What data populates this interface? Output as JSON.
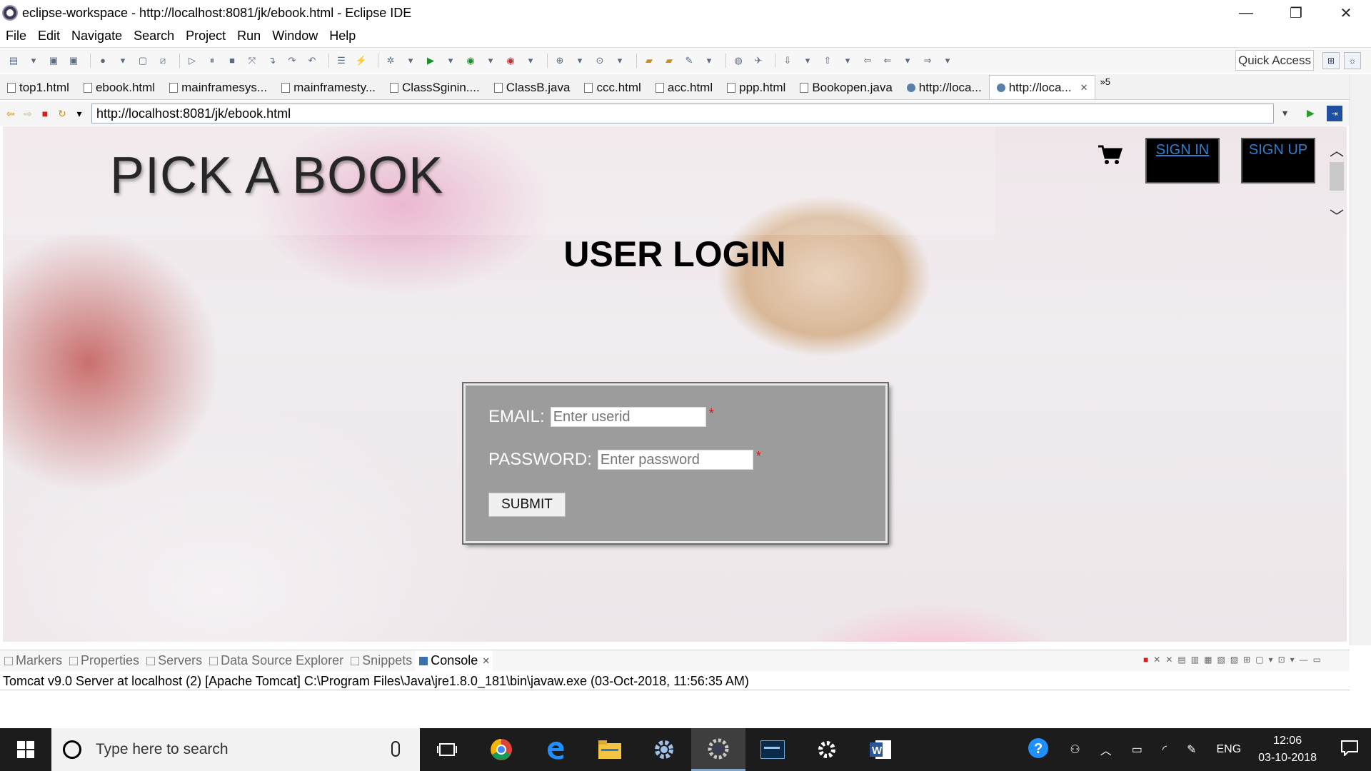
{
  "window": {
    "title": "eclipse-workspace - http://localhost:8081/jk/ebook.html - Eclipse IDE",
    "minimize": "—",
    "restore": "❐",
    "close": "✕"
  },
  "menu": [
    "File",
    "Edit",
    "Navigate",
    "Search",
    "Project",
    "Run",
    "Window",
    "Help"
  ],
  "toolbar": {
    "quick_access": "Quick Access"
  },
  "editor_tabs": [
    {
      "label": "top1.html",
      "kind": "file"
    },
    {
      "label": "ebook.html",
      "kind": "file"
    },
    {
      "label": "mainframesys...",
      "kind": "file"
    },
    {
      "label": "mainframesty...",
      "kind": "file"
    },
    {
      "label": "ClassSginin....",
      "kind": "file"
    },
    {
      "label": "ClassB.java",
      "kind": "file"
    },
    {
      "label": "ccc.html",
      "kind": "file"
    },
    {
      "label": "acc.html",
      "kind": "file"
    },
    {
      "label": "ppp.html",
      "kind": "file"
    },
    {
      "label": "Bookopen.java",
      "kind": "file"
    },
    {
      "label": "http://loca...",
      "kind": "web"
    },
    {
      "label": "http://loca...",
      "kind": "web",
      "active": true
    }
  ],
  "tab_overflow": "»5",
  "browser": {
    "url": "http://localhost:8081/jk/ebook.html"
  },
  "page": {
    "brand": "PICK A BOOK",
    "sign_in": "SIGN IN",
    "sign_up": "SIGN UP",
    "login_title": "USER LOGIN",
    "email_label": "EMAIL:",
    "email_placeholder": "Enter userid",
    "password_label": "PASSWORD:",
    "password_placeholder": "Enter password",
    "required_mark": "*",
    "submit": "SUBMIT"
  },
  "views": {
    "tabs": [
      "Markers",
      "Properties",
      "Servers",
      "Data Source Explorer",
      "Snippets",
      "Console"
    ],
    "active": "Console",
    "console_description": "Tomcat v9.0 Server at localhost (2) [Apache Tomcat] C:\\Program Files\\Java\\jre1.8.0_181\\bin\\javaw.exe (03-Oct-2018, 11:56:35 AM)"
  },
  "taskbar": {
    "search_placeholder": "Type here to search",
    "language": "ENG",
    "time": "12:06",
    "date": "03-10-2018"
  },
  "colors": {
    "auth_button_bg": "#000000",
    "auth_button_text": "#2f7fd1",
    "login_box_bg": "#9c9c9c",
    "taskbar_bg": "#1c1c1c"
  }
}
